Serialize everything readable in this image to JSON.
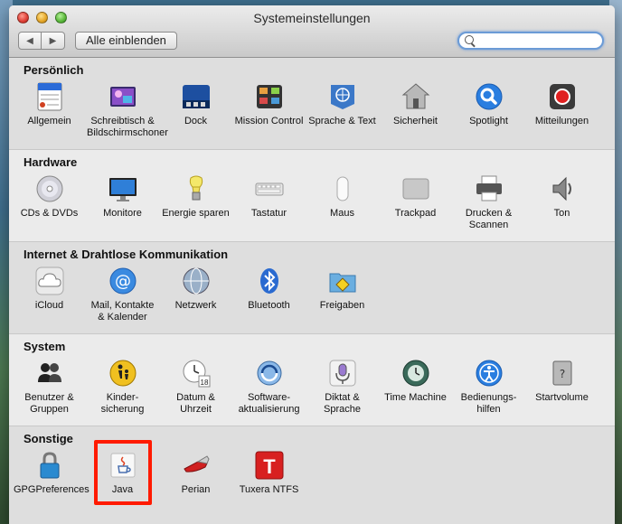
{
  "window": {
    "title": "Systemeinstellungen"
  },
  "toolbar": {
    "show_all_label": "Alle einblenden",
    "search_placeholder": ""
  },
  "sections": [
    {
      "title": "Persönlich",
      "items": [
        {
          "label": "Allgemein",
          "icon": "general-icon"
        },
        {
          "label": "Schreibtisch & Bildschirmschoner",
          "icon": "desktop-screensaver-icon"
        },
        {
          "label": "Dock",
          "icon": "dock-icon"
        },
        {
          "label": "Mission Control",
          "icon": "mission-control-icon"
        },
        {
          "label": "Sprache & Text",
          "icon": "language-text-icon"
        },
        {
          "label": "Sicherheit",
          "icon": "security-house-icon"
        },
        {
          "label": "Spotlight",
          "icon": "spotlight-icon"
        },
        {
          "label": "Mitteilungen",
          "icon": "notifications-icon"
        }
      ]
    },
    {
      "title": "Hardware",
      "items": [
        {
          "label": "CDs & DVDs",
          "icon": "disc-icon"
        },
        {
          "label": "Monitore",
          "icon": "monitor-icon"
        },
        {
          "label": "Energie sparen",
          "icon": "bulb-icon"
        },
        {
          "label": "Tastatur",
          "icon": "keyboard-icon"
        },
        {
          "label": "Maus",
          "icon": "mouse-icon"
        },
        {
          "label": "Trackpad",
          "icon": "trackpad-icon"
        },
        {
          "label": "Drucken & Scannen",
          "icon": "printer-icon"
        },
        {
          "label": "Ton",
          "icon": "speaker-icon"
        }
      ]
    },
    {
      "title": "Internet & Drahtlose Kommunikation",
      "items": [
        {
          "label": "iCloud",
          "icon": "icloud-icon"
        },
        {
          "label": "Mail, Kontakte & Kalender",
          "icon": "mail-at-icon"
        },
        {
          "label": "Netzwerk",
          "icon": "network-globe-icon"
        },
        {
          "label": "Bluetooth",
          "icon": "bluetooth-icon"
        },
        {
          "label": "Freigaben",
          "icon": "sharing-folder-icon"
        }
      ]
    },
    {
      "title": "System",
      "items": [
        {
          "label": "Benutzer & Gruppen",
          "icon": "users-icon"
        },
        {
          "label": "Kinder- sicherung",
          "icon": "parental-controls-icon"
        },
        {
          "label": "Datum & Uhrzeit",
          "icon": "clock-calendar-icon"
        },
        {
          "label": "Software- aktualisierung",
          "icon": "software-update-icon"
        },
        {
          "label": "Diktat & Sprache",
          "icon": "microphone-icon"
        },
        {
          "label": "Time Machine",
          "icon": "time-machine-icon"
        },
        {
          "label": "Bedienungs- hilfen",
          "icon": "accessibility-icon"
        },
        {
          "label": "Startvolume",
          "icon": "startup-disk-icon"
        }
      ]
    },
    {
      "title": "Sonstige",
      "items": [
        {
          "label": "GPGPreferences",
          "icon": "gpg-lock-icon"
        },
        {
          "label": "Java",
          "icon": "java-icon"
        },
        {
          "label": "Perian",
          "icon": "perian-knife-icon"
        },
        {
          "label": "Tuxera NTFS",
          "icon": "tuxera-icon"
        }
      ]
    }
  ]
}
